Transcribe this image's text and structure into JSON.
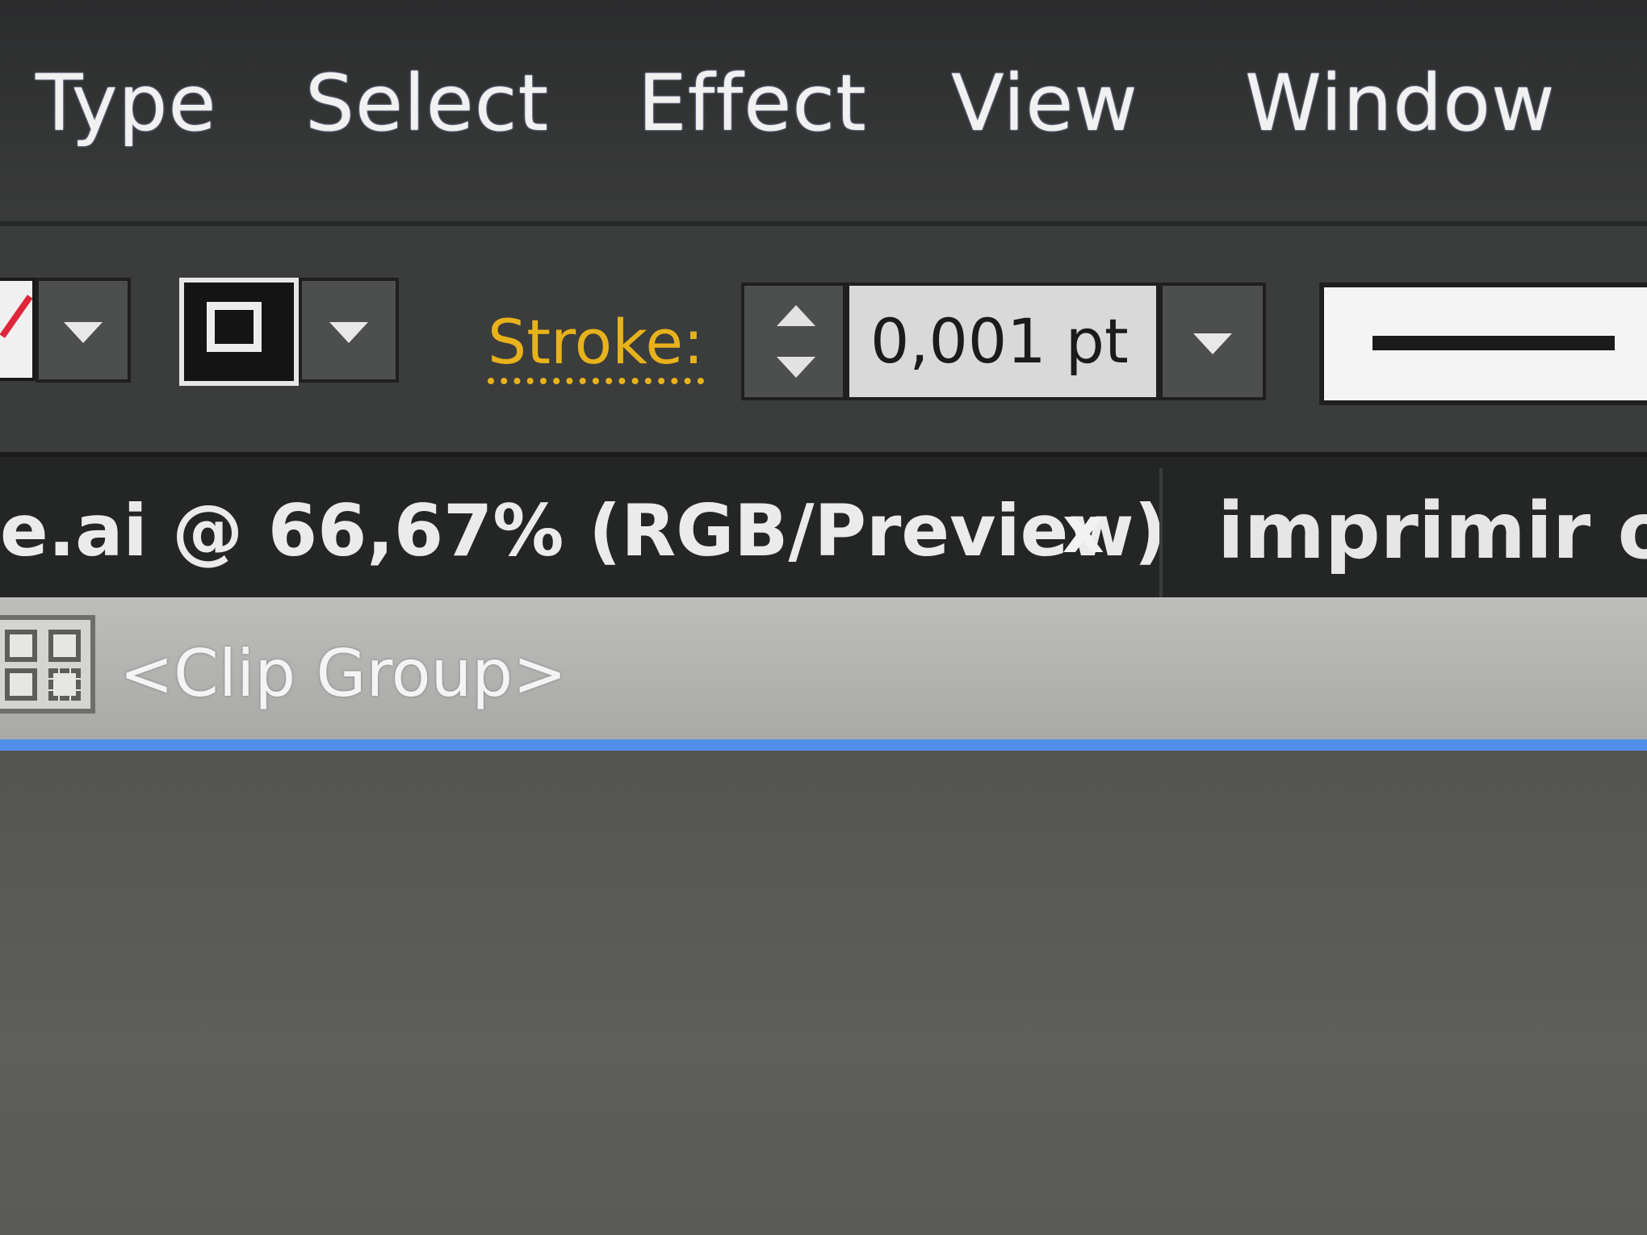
{
  "menubar": {
    "items": [
      {
        "label": "Type"
      },
      {
        "label": "Select"
      },
      {
        "label": "Effect"
      },
      {
        "label": "View"
      },
      {
        "label": "Window"
      }
    ]
  },
  "controlbar": {
    "fill_icon": "fill-none-swatch-icon",
    "stroke_icon": "stroke-swatch-icon",
    "stroke_label": "Stroke:",
    "stroke_weight": "0,001 pt",
    "colors": {
      "stroke_label": "#e8b21b",
      "selection_line": "#4f8fe8"
    }
  },
  "tabs": {
    "active_title": "e.ai @ 66,67% (RGB/Preview)",
    "close_label": "x",
    "second_title": "imprimir ok"
  },
  "isolation": {
    "icon": "clip-group-icon",
    "label": "<Clip Group>"
  }
}
